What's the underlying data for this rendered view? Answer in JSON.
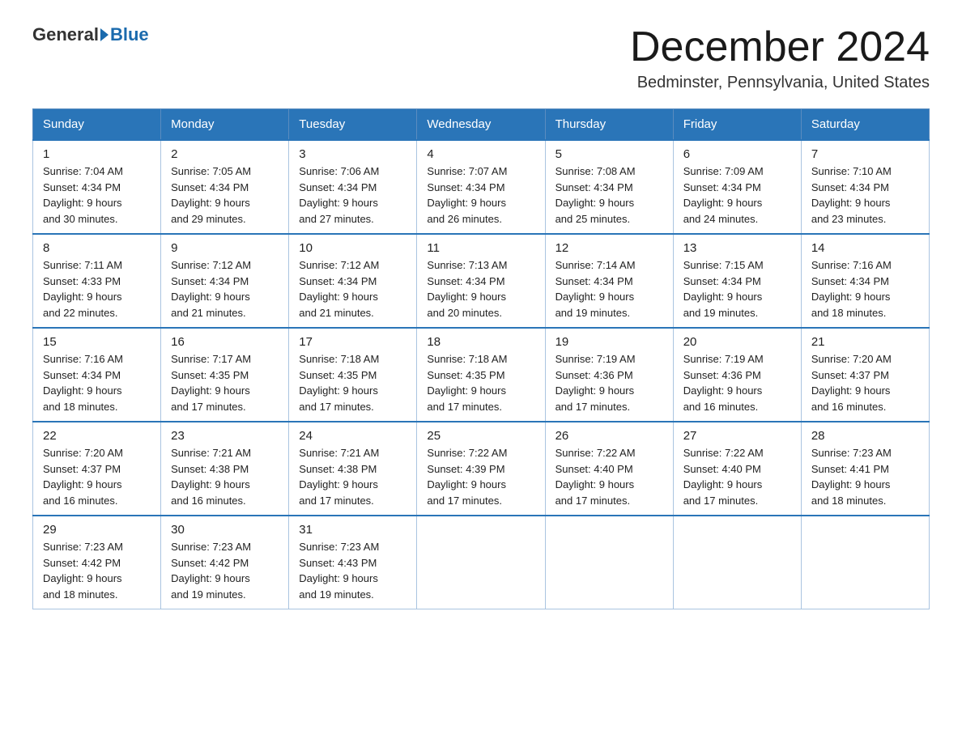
{
  "header": {
    "logo_general": "General",
    "logo_blue": "Blue",
    "month_title": "December 2024",
    "location": "Bedminster, Pennsylvania, United States"
  },
  "weekdays": [
    "Sunday",
    "Monday",
    "Tuesday",
    "Wednesday",
    "Thursday",
    "Friday",
    "Saturday"
  ],
  "weeks": [
    [
      {
        "day": "1",
        "sunrise": "7:04 AM",
        "sunset": "4:34 PM",
        "daylight": "9 hours and 30 minutes."
      },
      {
        "day": "2",
        "sunrise": "7:05 AM",
        "sunset": "4:34 PM",
        "daylight": "9 hours and 29 minutes."
      },
      {
        "day": "3",
        "sunrise": "7:06 AM",
        "sunset": "4:34 PM",
        "daylight": "9 hours and 27 minutes."
      },
      {
        "day": "4",
        "sunrise": "7:07 AM",
        "sunset": "4:34 PM",
        "daylight": "9 hours and 26 minutes."
      },
      {
        "day": "5",
        "sunrise": "7:08 AM",
        "sunset": "4:34 PM",
        "daylight": "9 hours and 25 minutes."
      },
      {
        "day": "6",
        "sunrise": "7:09 AM",
        "sunset": "4:34 PM",
        "daylight": "9 hours and 24 minutes."
      },
      {
        "day": "7",
        "sunrise": "7:10 AM",
        "sunset": "4:34 PM",
        "daylight": "9 hours and 23 minutes."
      }
    ],
    [
      {
        "day": "8",
        "sunrise": "7:11 AM",
        "sunset": "4:33 PM",
        "daylight": "9 hours and 22 minutes."
      },
      {
        "day": "9",
        "sunrise": "7:12 AM",
        "sunset": "4:34 PM",
        "daylight": "9 hours and 21 minutes."
      },
      {
        "day": "10",
        "sunrise": "7:12 AM",
        "sunset": "4:34 PM",
        "daylight": "9 hours and 21 minutes."
      },
      {
        "day": "11",
        "sunrise": "7:13 AM",
        "sunset": "4:34 PM",
        "daylight": "9 hours and 20 minutes."
      },
      {
        "day": "12",
        "sunrise": "7:14 AM",
        "sunset": "4:34 PM",
        "daylight": "9 hours and 19 minutes."
      },
      {
        "day": "13",
        "sunrise": "7:15 AM",
        "sunset": "4:34 PM",
        "daylight": "9 hours and 19 minutes."
      },
      {
        "day": "14",
        "sunrise": "7:16 AM",
        "sunset": "4:34 PM",
        "daylight": "9 hours and 18 minutes."
      }
    ],
    [
      {
        "day": "15",
        "sunrise": "7:16 AM",
        "sunset": "4:34 PM",
        "daylight": "9 hours and 18 minutes."
      },
      {
        "day": "16",
        "sunrise": "7:17 AM",
        "sunset": "4:35 PM",
        "daylight": "9 hours and 17 minutes."
      },
      {
        "day": "17",
        "sunrise": "7:18 AM",
        "sunset": "4:35 PM",
        "daylight": "9 hours and 17 minutes."
      },
      {
        "day": "18",
        "sunrise": "7:18 AM",
        "sunset": "4:35 PM",
        "daylight": "9 hours and 17 minutes."
      },
      {
        "day": "19",
        "sunrise": "7:19 AM",
        "sunset": "4:36 PM",
        "daylight": "9 hours and 17 minutes."
      },
      {
        "day": "20",
        "sunrise": "7:19 AM",
        "sunset": "4:36 PM",
        "daylight": "9 hours and 16 minutes."
      },
      {
        "day": "21",
        "sunrise": "7:20 AM",
        "sunset": "4:37 PM",
        "daylight": "9 hours and 16 minutes."
      }
    ],
    [
      {
        "day": "22",
        "sunrise": "7:20 AM",
        "sunset": "4:37 PM",
        "daylight": "9 hours and 16 minutes."
      },
      {
        "day": "23",
        "sunrise": "7:21 AM",
        "sunset": "4:38 PM",
        "daylight": "9 hours and 16 minutes."
      },
      {
        "day": "24",
        "sunrise": "7:21 AM",
        "sunset": "4:38 PM",
        "daylight": "9 hours and 17 minutes."
      },
      {
        "day": "25",
        "sunrise": "7:22 AM",
        "sunset": "4:39 PM",
        "daylight": "9 hours and 17 minutes."
      },
      {
        "day": "26",
        "sunrise": "7:22 AM",
        "sunset": "4:40 PM",
        "daylight": "9 hours and 17 minutes."
      },
      {
        "day": "27",
        "sunrise": "7:22 AM",
        "sunset": "4:40 PM",
        "daylight": "9 hours and 17 minutes."
      },
      {
        "day": "28",
        "sunrise": "7:23 AM",
        "sunset": "4:41 PM",
        "daylight": "9 hours and 18 minutes."
      }
    ],
    [
      {
        "day": "29",
        "sunrise": "7:23 AM",
        "sunset": "4:42 PM",
        "daylight": "9 hours and 18 minutes."
      },
      {
        "day": "30",
        "sunrise": "7:23 AM",
        "sunset": "4:42 PM",
        "daylight": "9 hours and 19 minutes."
      },
      {
        "day": "31",
        "sunrise": "7:23 AM",
        "sunset": "4:43 PM",
        "daylight": "9 hours and 19 minutes."
      },
      null,
      null,
      null,
      null
    ]
  ],
  "labels": {
    "sunrise_prefix": "Sunrise: ",
    "sunset_prefix": "Sunset: ",
    "daylight_prefix": "Daylight: "
  }
}
